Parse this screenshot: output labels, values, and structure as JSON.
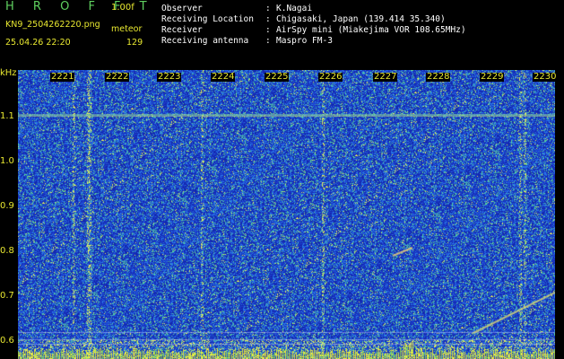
{
  "app": {
    "title": "H R O F F T",
    "version": "1.00f"
  },
  "file": {
    "name": "KN9_2504262220.png",
    "timestamp": "25.04.26 22:20",
    "mode_label": "meteor",
    "count": "129"
  },
  "metadata": [
    {
      "label": "Observer",
      "value": "K.Nagai"
    },
    {
      "label": "Receiving Location",
      "value": "Chigasaki, Japan (139.414 35.340)"
    },
    {
      "label": "Receiver",
      "value": "AirSpy mini (Miakejima VOR 108.65MHz)"
    },
    {
      "label": "Receiving antenna",
      "value": "Maspro FM-3"
    }
  ],
  "axis": {
    "y_unit": "kHz",
    "y_ticks": [
      "1.1",
      "1.0",
      "0.9",
      "0.8",
      "0.7",
      "0.6"
    ],
    "x_ticks": [
      "2221",
      "2222",
      "2223",
      "2224",
      "2225",
      "2226",
      "2227",
      "2228",
      "2229",
      "2230"
    ]
  },
  "colors": {
    "background": "#000000",
    "spectrum_base": "#1a35c8",
    "label_yellow": "#e8e830",
    "title_green": "#5fd05f",
    "signal_green": "#7ad07a"
  }
}
